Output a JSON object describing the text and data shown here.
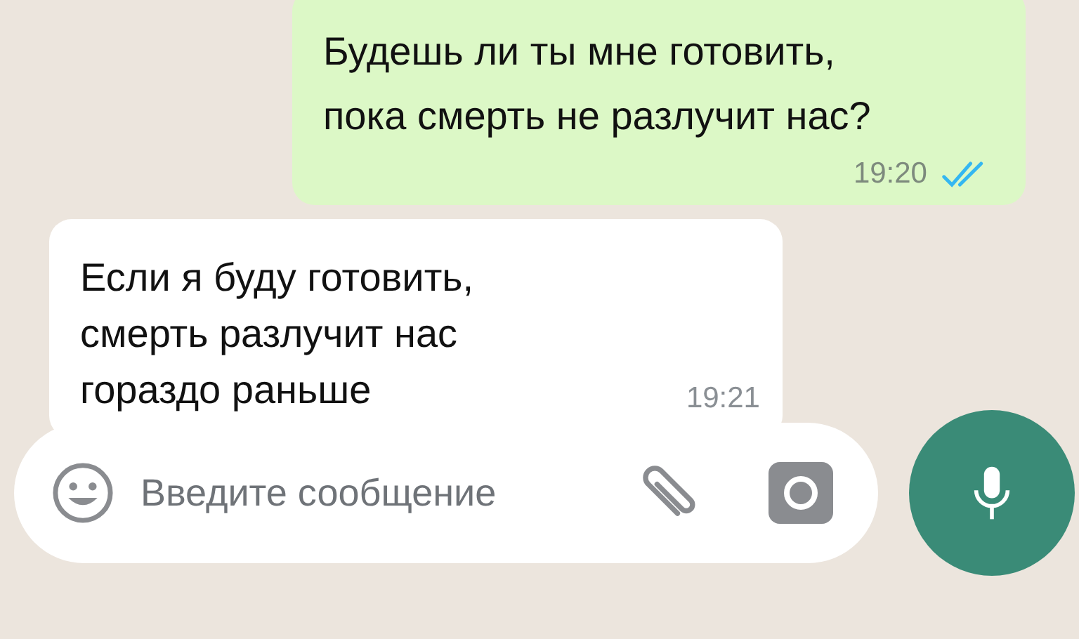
{
  "messages": [
    {
      "kind": "outgoing",
      "text": "Будешь ли ты мне готовить,\nпока смерть не разлучит нас?",
      "time": "19:20",
      "read": true
    },
    {
      "kind": "incoming",
      "text": "Если я буду готовить,\nсмерть разлучит нас\nгораздо раньше",
      "time": "19:21"
    }
  ],
  "composer": {
    "placeholder": "Введите сообщение"
  }
}
